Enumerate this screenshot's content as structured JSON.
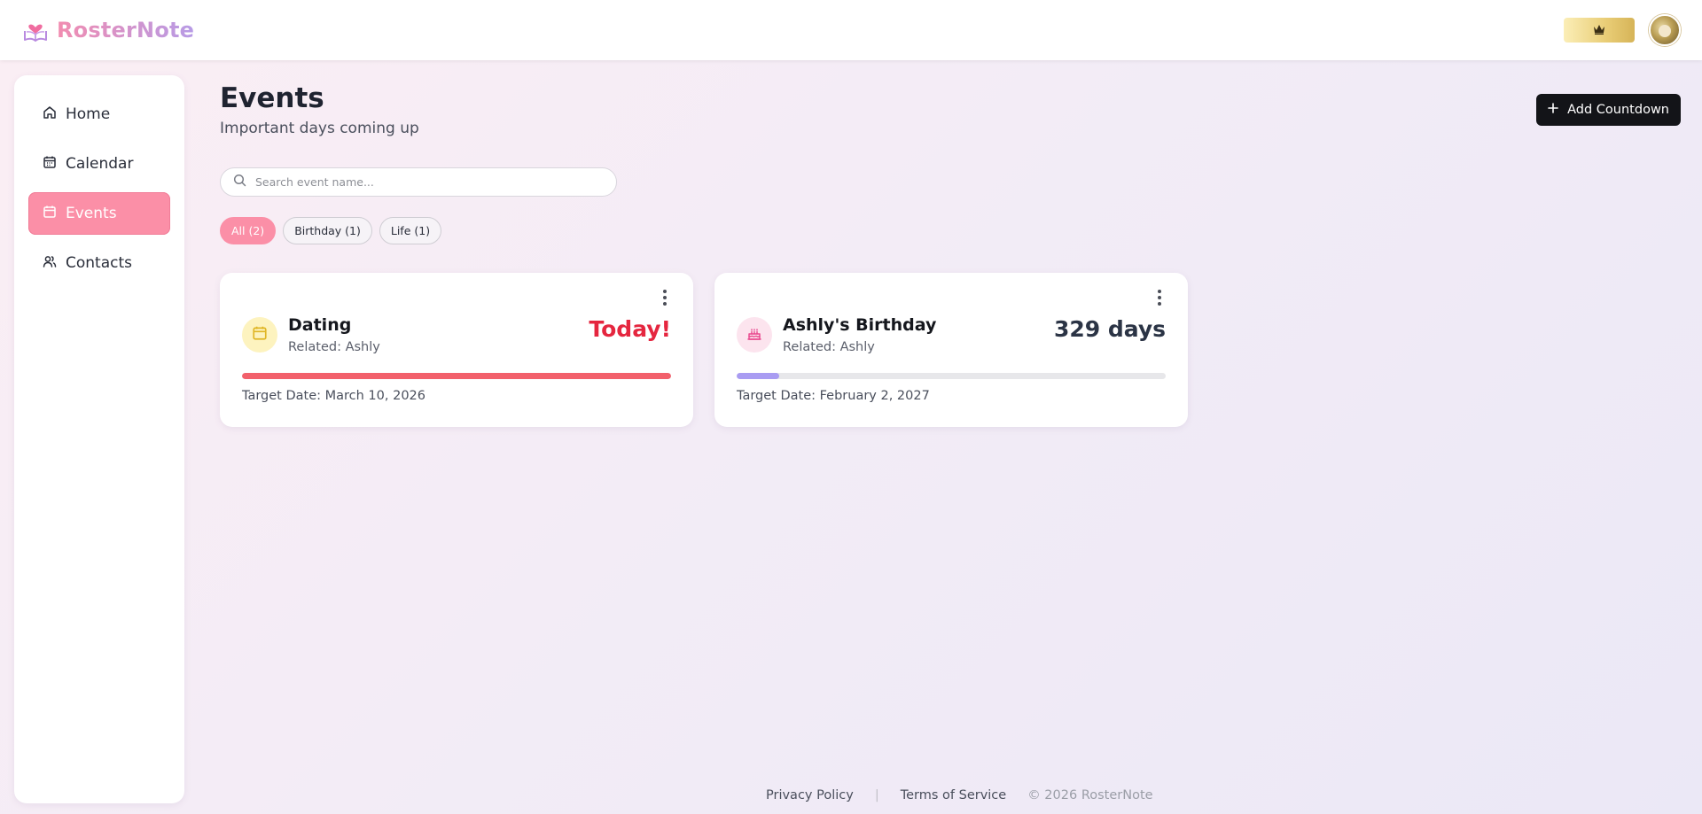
{
  "app": {
    "name": "RosterNote",
    "brand_gradient": [
      "#f28cb0",
      "#b79be6"
    ],
    "logo_icon": "heart-book-icon"
  },
  "header": {
    "premium_icon": "crown-icon",
    "avatar_icon": "avatar"
  },
  "sidebar": {
    "items": [
      {
        "label": "Home",
        "icon": "home-icon",
        "active": false
      },
      {
        "label": "Calendar",
        "icon": "calendar-icon",
        "active": false
      },
      {
        "label": "Events",
        "icon": "calendar-icon",
        "active": true
      },
      {
        "label": "Contacts",
        "icon": "users-icon",
        "active": false
      }
    ],
    "active_color": "#fb8fa7"
  },
  "main": {
    "title": "Events",
    "subtitle": "Important days coming up",
    "add_button_label": "Add Countdown",
    "search": {
      "placeholder": "Search event name...",
      "value": ""
    },
    "filters": [
      {
        "label": "All (2)",
        "active": true
      },
      {
        "label": "Birthday (1)",
        "active": false
      },
      {
        "label": "Life (1)",
        "active": false
      }
    ],
    "events": [
      {
        "title": "Dating",
        "related": "Related: Ashly",
        "countdown": "Today!",
        "target_date": "Target Date: March 10, 2026",
        "icon": "calendar-icon",
        "icon_bg": "#fdf3bf",
        "icon_color": "#e0b626",
        "progress": 1.0,
        "progress_color": "#f2606b"
      },
      {
        "title": "Ashly's Birthday",
        "related": "Related: Ashly",
        "countdown": "329 days",
        "target_date": "Target Date: February 2, 2027",
        "icon": "cake-icon",
        "icon_bg": "#fce4ee",
        "icon_color": "#e9488e",
        "progress": 0.1,
        "progress_color": "#a99cf2"
      }
    ]
  },
  "footer": {
    "privacy": "Privacy Policy",
    "separator": "|",
    "terms": "Terms of Service",
    "copyright": "© 2026 RosterNote"
  }
}
